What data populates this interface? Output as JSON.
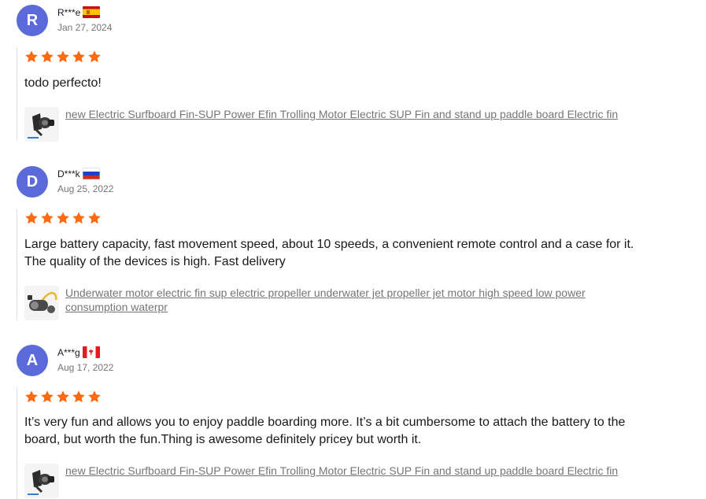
{
  "reviews": [
    {
      "initial": "R",
      "name": "R***e",
      "country": "spain-flag",
      "date": "Jan 27, 2024",
      "rating": 5,
      "text": "todo perfecto!",
      "product": "new Electric Surfboard Fin-SUP Power Efin Trolling Motor Electric SUP Fin and stand up paddle board Electric fin"
    },
    {
      "initial": "D",
      "name": "D***k",
      "country": "russia-flag",
      "date": "Aug 25, 2022",
      "rating": 5,
      "text": "Large battery capacity, fast movement speed, about 10 speeds, a convenient remote control and a case for it. The quality of the devices is high. Fast delivery",
      "product": "Underwater motor electric fin sup electric propeller underwater jet propeller jet motor high speed low power consumption waterpr"
    },
    {
      "initial": "A",
      "name": "A***g",
      "country": "canada-flag",
      "date": "Aug 17, 2022",
      "rating": 5,
      "text": "It’s very fun and allows you to enjoy paddle boarding more. It’s a bit cumbersome to attach the battery to the board, but worth the fun.Thing is awesome definitely pricey but worth it.",
      "product": "new Electric Surfboard Fin-SUP Power Efin Trolling Motor Electric SUP Fin and stand up paddle board Electric fin"
    }
  ],
  "colors": {
    "avatar": "#5a6ad8",
    "star": "#fd6a12",
    "link": "#757575"
  }
}
